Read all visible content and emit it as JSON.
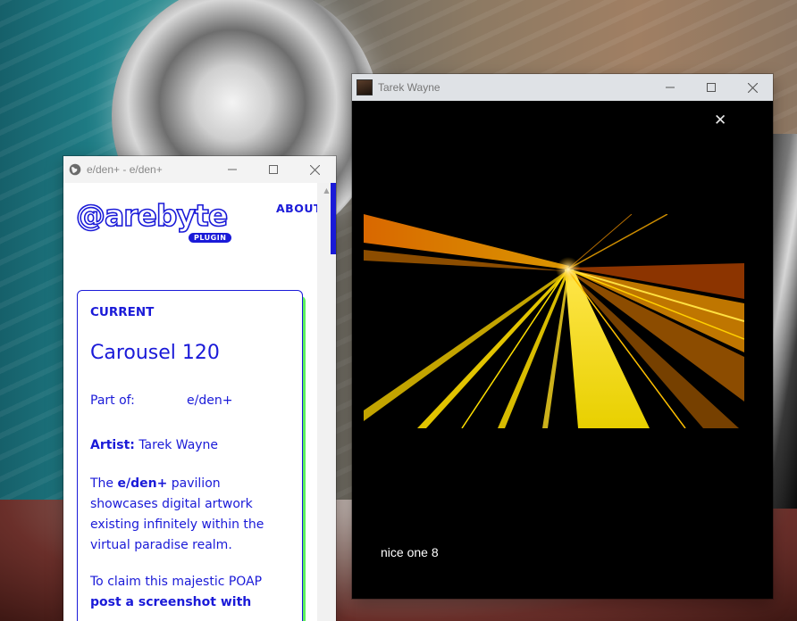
{
  "browser_window": {
    "title": "e/den+ - e/den+",
    "logo": {
      "text": "arebyte",
      "badge": "PLUGIN"
    },
    "nav": {
      "about": "ABOUT"
    },
    "card": {
      "label": "CURRENT",
      "title": "Carousel 120",
      "part_label": "Part of:",
      "part_value": "e/den+",
      "artist_label": "Artist:",
      "artist_name": "Tarek Wayne",
      "desc_pre": "The",
      "desc_bold": "e/den+",
      "desc_post": "pavilion showcases digital artwork existing infinitely within the virtual paradise realm.",
      "claim_pre": "To claim this majestic POAP",
      "claim_bold": "post a screenshot with"
    },
    "accent_color": "#1a1ad8",
    "shadow_color": "#5cf05c"
  },
  "video_window": {
    "title": "Tarek Wayne",
    "caption": "nice one 8"
  },
  "icons": {
    "browser_favicon": "globe-icon",
    "video_avatar": "avatar-icon",
    "minimize": "minimize-icon",
    "maximize": "maximize-icon",
    "close": "close-icon"
  }
}
